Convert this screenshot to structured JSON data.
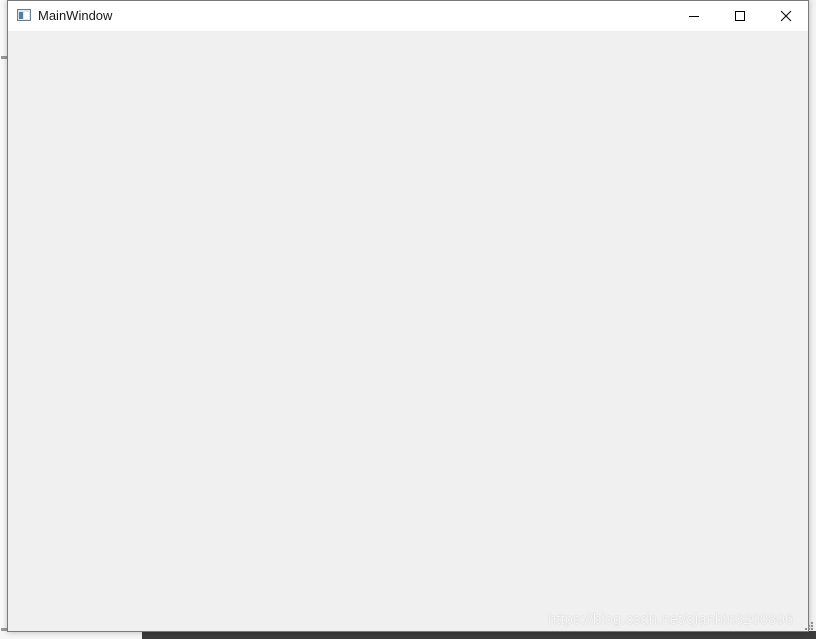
{
  "window": {
    "title": "MainWindow",
    "icon": "qt-window-icon",
    "controls": {
      "minimize": "minimize-icon",
      "maximize": "maximize-icon",
      "close": "close-icon"
    }
  },
  "overlay": {
    "watermark": "https://blog.csdn.net/qianbin3200896"
  },
  "colors": {
    "titlebar": "#ffffff",
    "client": "#f0f0f0",
    "border": "#7a7a7a",
    "taskbar": "#3c3c3c"
  }
}
